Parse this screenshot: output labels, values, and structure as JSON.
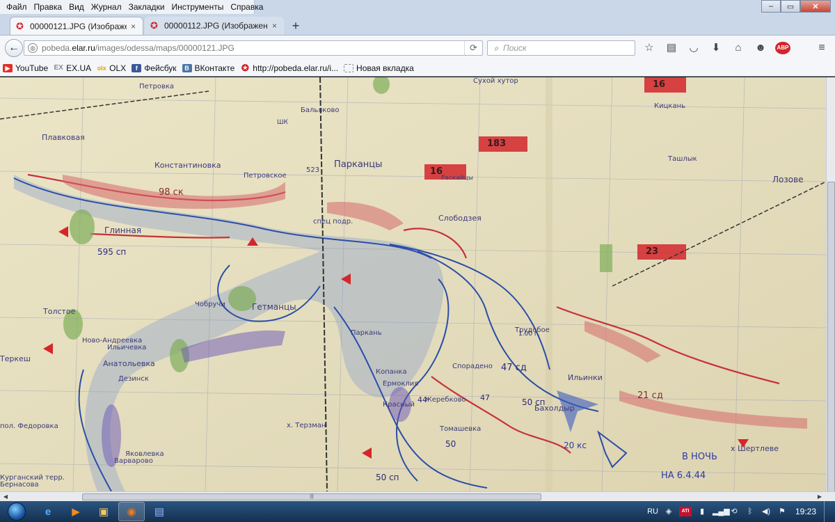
{
  "menu": [
    "Файл",
    "Правка",
    "Вид",
    "Журнал",
    "Закладки",
    "Инструменты",
    "Справка"
  ],
  "window_controls": {
    "minimize": "–",
    "maximize": "▭",
    "close": "✕"
  },
  "tabs": [
    {
      "title": "00000121.JPG (Изображен...",
      "close": "×"
    },
    {
      "title": "00000112.JPG (Изображен...",
      "close": "×"
    }
  ],
  "newtab_label": "+",
  "nav": {
    "back": "←",
    "url_prefix": "pobeda.",
    "url_domain": "elar.ru",
    "url_suffix": "/images/odessa/maps/00000121.JPG",
    "reload": "⟳",
    "search_placeholder": "Поиск",
    "icons": [
      "star-icon",
      "reader-icon",
      "pocket-icon",
      "download-icon",
      "home-icon",
      "chat-icon",
      "adblock-icon"
    ],
    "abp_label": "ABP"
  },
  "bookmarks": [
    {
      "label": "YouTube",
      "icon": "youtube-icon",
      "glyph": "▶"
    },
    {
      "label": "EX.UA",
      "icon": "exua-icon",
      "glyph": "EX"
    },
    {
      "label": "OLX",
      "icon": "olx-icon",
      "glyph": "olx"
    },
    {
      "label": "Фейсбук",
      "icon": "facebook-icon",
      "glyph": "f"
    },
    {
      "label": "ВКонтакте",
      "icon": "vk-icon",
      "glyph": "B"
    },
    {
      "label": "http://pobeda.elar.ru/i...",
      "icon": "star-icon",
      "glyph": "✪"
    },
    {
      "label": "Новая вкладка",
      "icon": "blank-page-icon",
      "glyph": ""
    }
  ],
  "map": {
    "labels": [
      {
        "text": "Петровка",
        "color": "#3a3a7a"
      },
      {
        "text": "Плавковая",
        "color": "#3a3a7a"
      },
      {
        "text": "Константиновка",
        "color": "#3a3a7a"
      },
      {
        "text": "Петровское",
        "color": "#3a3a7a"
      },
      {
        "text": "523",
        "color": "#3a3a7a"
      },
      {
        "text": "Парканцы",
        "color": "#3a3a7a"
      },
      {
        "text": "Бальяково",
        "color": "#3a3a7a"
      },
      {
        "text": "ШК",
        "color": "#3a3a7a"
      },
      {
        "text": "Сухой хутор",
        "color": "#3a3a7a"
      },
      {
        "text": "Кицкань",
        "color": "#3a3a7a"
      },
      {
        "text": "Ташлык",
        "color": "#3a3a7a"
      },
      {
        "text": "Раскайцы",
        "color": "#3a3a7a"
      },
      {
        "text": "Слободзея",
        "color": "#3a3a7a"
      },
      {
        "text": "98 ск",
        "color": "#8a2a2a"
      },
      {
        "text": "спец подр.",
        "color": "#3a3a7a"
      },
      {
        "text": "Глинная",
        "color": "#3a3a7a"
      },
      {
        "text": "595 сп",
        "color": "#2a2a7a"
      },
      {
        "text": "Толстое",
        "color": "#3a3a7a"
      },
      {
        "text": "Гетманцы",
        "color": "#3a3a7a"
      },
      {
        "text": "Чобручи",
        "color": "#3a3a7a"
      },
      {
        "text": "Паркань",
        "color": "#3a3a7a"
      },
      {
        "text": "Копанка",
        "color": "#3a3a7a"
      },
      {
        "text": "Ново-Андреевка",
        "color": "#3a3a7a"
      },
      {
        "text": "Ильичевка",
        "color": "#3a3a7a"
      },
      {
        "text": "Анатольевка",
        "color": "#3a3a7a"
      },
      {
        "text": "Дезинск",
        "color": "#3a3a7a"
      },
      {
        "text": "Теркеш",
        "color": "#3a3a7a"
      },
      {
        "text": "х. Терзман",
        "color": "#3a3a7a"
      },
      {
        "text": "Трудобое",
        "color": "#3a3a7a"
      },
      {
        "text": "Жеребково",
        "color": "#3a3a7a"
      },
      {
        "text": "Ермоклия",
        "color": "#3a3a7a"
      },
      {
        "text": "Варварово",
        "color": "#3a3a7a"
      },
      {
        "text": "Яковлевка",
        "color": "#3a3a7a"
      },
      {
        "text": "пол. Федоровка",
        "color": "#3a3a7a"
      },
      {
        "text": "Бернасова",
        "color": "#3a3a7a"
      },
      {
        "text": "Бахолдыр",
        "color": "#3a3a7a"
      },
      {
        "text": "Томашевка",
        "color": "#3a3a7a"
      },
      {
        "text": "Ильинки",
        "color": "#3a3a7a"
      },
      {
        "text": "х Шертлеве",
        "color": "#3a3a7a"
      },
      {
        "text": "Лозове",
        "color": "#3a3a7a"
      },
      {
        "text": "Спорадено",
        "color": "#3a3a7a"
      },
      {
        "text": "Красный",
        "color": "#3a3a7a"
      },
      {
        "text": "В НОЧЬ",
        "color": "#2a3aa8"
      },
      {
        "text": "НА 6.4.44",
        "color": "#2a3aa8"
      },
      {
        "text": "20 кс",
        "color": "#2a3aa8"
      },
      {
        "text": "21 сд",
        "color": "#8a2a2a"
      },
      {
        "text": "47 сд",
        "color": "#2a2a7a"
      },
      {
        "text": "50 сп",
        "color": "#2a2a7a"
      },
      {
        "text": "50 сп",
        "color": "#2a2a7a"
      },
      {
        "text": "50",
        "color": "#2a2a7a"
      },
      {
        "text": "47",
        "color": "#2a2a7a"
      },
      {
        "text": "44",
        "color": "#2a2a7a"
      },
      {
        "text": "1.00 г.",
        "color": "#2a2a7a"
      },
      {
        "text": "Курганский терр.",
        "color": "#3a3a7a"
      }
    ],
    "flags": [
      "183",
      "16",
      "23",
      "16"
    ]
  },
  "scrollbar_grip": "|||",
  "taskbar": {
    "apps": [
      {
        "name": "ie-icon",
        "glyph": "e"
      },
      {
        "name": "media-player-icon",
        "glyph": "▶"
      },
      {
        "name": "folder-icon",
        "glyph": "▣"
      },
      {
        "name": "firefox-icon",
        "glyph": "◉"
      },
      {
        "name": "save-icon",
        "glyph": "▤"
      }
    ],
    "lang": "RU",
    "ati": "ATI",
    "clock": "19:23"
  },
  "colors": {
    "map_paper": "#e6dfc0",
    "red_line": "#c8303a",
    "blue_line": "#2a4ea8",
    "river": "#6e88c8"
  }
}
